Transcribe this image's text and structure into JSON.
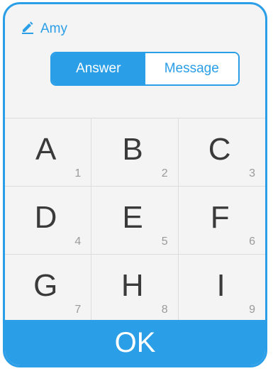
{
  "header": {
    "user_name": "Amy",
    "icon": "pencil-icon"
  },
  "mode_toggle": {
    "answer_label": "Answer",
    "message_label": "Message",
    "selected": "Answer"
  },
  "keys": [
    {
      "letter": "A",
      "number": "1"
    },
    {
      "letter": "B",
      "number": "2"
    },
    {
      "letter": "C",
      "number": "3"
    },
    {
      "letter": "D",
      "number": "4"
    },
    {
      "letter": "E",
      "number": "5"
    },
    {
      "letter": "F",
      "number": "6"
    },
    {
      "letter": "G",
      "number": "7"
    },
    {
      "letter": "H",
      "number": "8"
    },
    {
      "letter": "I",
      "number": "9"
    }
  ],
  "footer": {
    "ok_label": "OK"
  },
  "colors": {
    "accent": "#2b9ee8",
    "background": "#f4f4f4",
    "key_text": "#3a3a3a",
    "key_number": "#9a9a9a"
  }
}
